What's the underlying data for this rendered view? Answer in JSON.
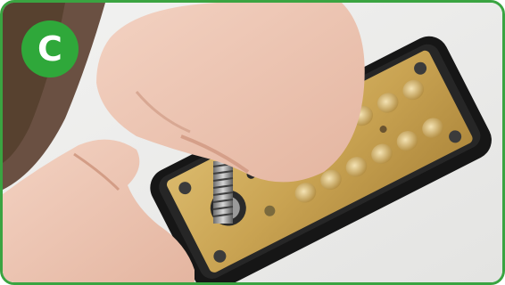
{
  "step": {
    "letter": "C",
    "badge_color": "#2fa83a",
    "frame_color": "#3aa441"
  },
  "photo": {
    "subject": "hand-tightening-spindle-on-mechanical-push-button-keypad-lock"
  }
}
